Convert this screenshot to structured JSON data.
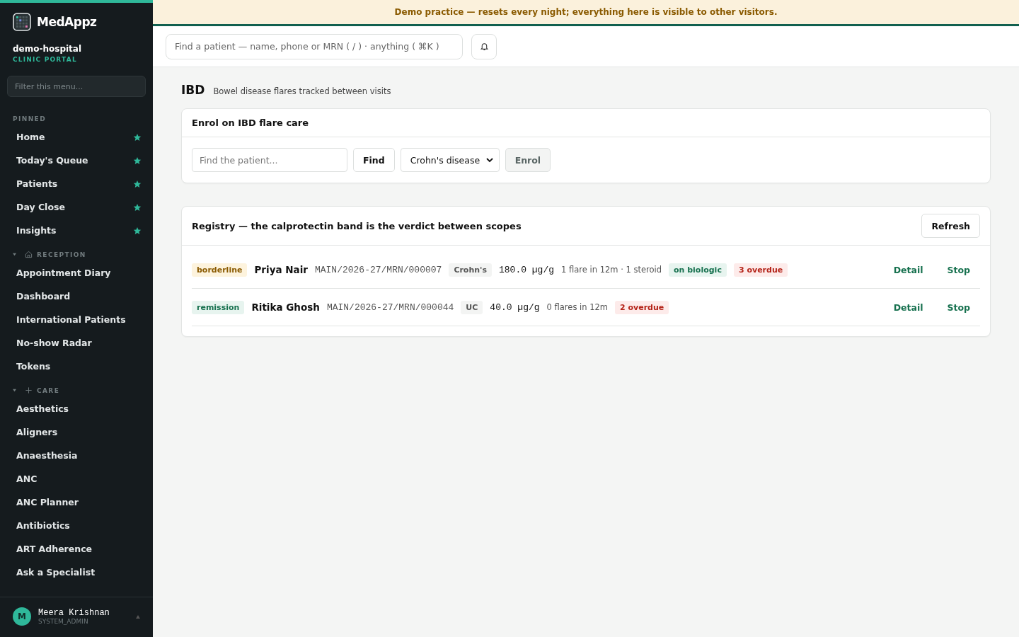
{
  "brand": {
    "name": "MedAppz",
    "org": "demo-hospital",
    "portal": "CLINIC PORTAL"
  },
  "sidebar": {
    "filter_placeholder": "Filter this menu...",
    "sections": [
      {
        "title": "PINNED",
        "kind": "plain",
        "items": [
          {
            "label": "Home",
            "pinned": true
          },
          {
            "label": "Today's Queue",
            "pinned": true
          },
          {
            "label": "Patients",
            "pinned": true
          },
          {
            "label": "Day Close",
            "pinned": true
          },
          {
            "label": "Insights",
            "pinned": true
          }
        ]
      },
      {
        "title": "RECEPTION",
        "kind": "reception",
        "expanded": true,
        "items": [
          {
            "label": "Appointment Diary",
            "pinned": false
          },
          {
            "label": "Dashboard",
            "pinned": false
          },
          {
            "label": "International Patients",
            "pinned": false
          },
          {
            "label": "No-show Radar",
            "pinned": false
          },
          {
            "label": "Tokens",
            "pinned": false
          }
        ]
      },
      {
        "title": "CARE",
        "kind": "care",
        "expanded": true,
        "items": [
          {
            "label": "Aesthetics",
            "pinned": false
          },
          {
            "label": "Aligners",
            "pinned": false
          },
          {
            "label": "Anaesthesia",
            "pinned": false
          },
          {
            "label": "ANC",
            "pinned": false
          },
          {
            "label": "ANC Planner",
            "pinned": false
          },
          {
            "label": "Antibiotics",
            "pinned": false
          },
          {
            "label": "ART Adherence",
            "pinned": false
          },
          {
            "label": "Ask a Specialist",
            "pinned": false
          }
        ]
      }
    ],
    "user": {
      "initial": "M",
      "name": "Meera Krishnan",
      "role": "SYSTEM_ADMIN"
    }
  },
  "banner": "Demo practice — resets every night; everything here is visible to other visitors.",
  "topbar": {
    "search_placeholder": "Find a patient — name, phone or MRN ( / ) · anything ( ⌘K )"
  },
  "page": {
    "title": "IBD",
    "subtitle": "Bowel disease flares tracked between visits"
  },
  "enrol": {
    "title": "Enrol on IBD flare care",
    "patient_placeholder": "Find the patient...",
    "find_button": "Find",
    "disease": "Crohn's disease",
    "enrol_button": "Enrol",
    "enrol_disabled": true
  },
  "registry": {
    "title": "Registry — the calprotectin band is the verdict between scopes",
    "refresh_button": "Refresh",
    "rows": [
      {
        "band": {
          "text": "borderline",
          "kind": "warn"
        },
        "name": "Priya Nair",
        "mrn": "MAIN/2026-27/MRN/000007",
        "disease": "Crohn's",
        "calprotectin": "180.0 µg/g",
        "flares": "1 flare in 12m · 1 steroid",
        "tags": [
          {
            "text": "on biologic",
            "kind": "good"
          },
          {
            "text": "3 overdue",
            "kind": "bad"
          }
        ],
        "actions": [
          "Detail",
          "Stop"
        ]
      },
      {
        "band": {
          "text": "remission",
          "kind": "good"
        },
        "name": "Ritika Ghosh",
        "mrn": "MAIN/2026-27/MRN/000044",
        "disease": "UC",
        "calprotectin": "40.0 µg/g",
        "flares": "0 flares in 12m",
        "tags": [
          {
            "text": "2 overdue",
            "kind": "bad"
          }
        ],
        "actions": [
          "Detail",
          "Stop"
        ]
      }
    ]
  }
}
